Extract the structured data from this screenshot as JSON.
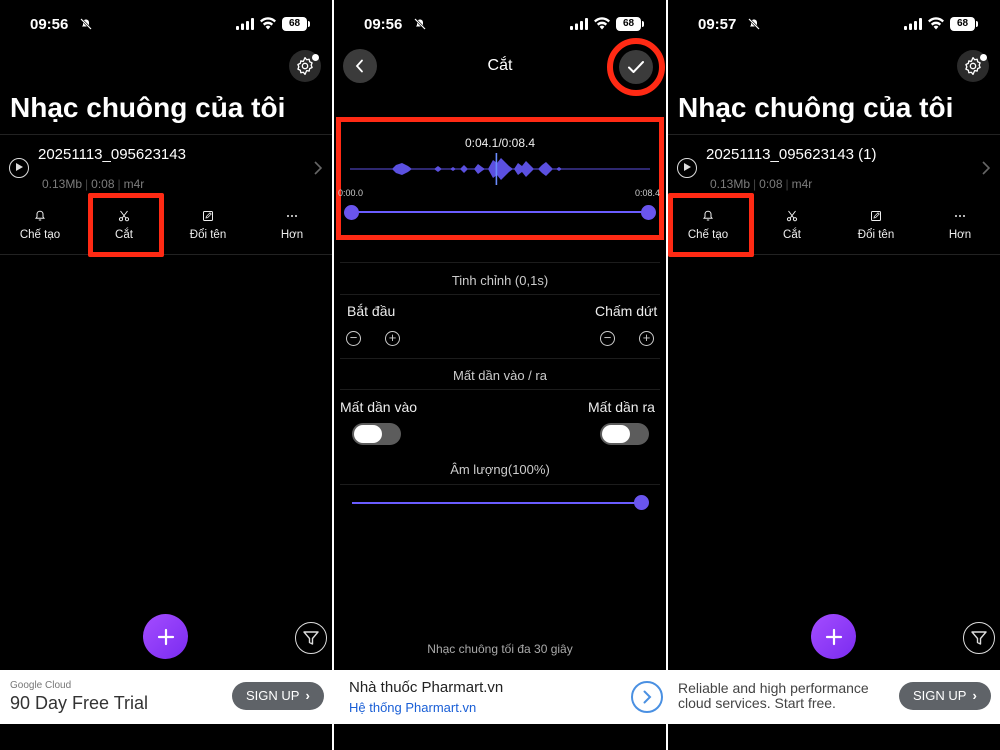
{
  "status_bars": [
    {
      "time": "09:56",
      "battery": "68"
    },
    {
      "time": "09:56",
      "battery": "68"
    },
    {
      "time": "09:57",
      "battery": "68"
    }
  ],
  "colors": {
    "highlight": "#ff2a14",
    "accent": "#6a5cff",
    "fab": "#8c3cf6",
    "background": "#000000"
  },
  "list_screen_1": {
    "title": "Nhạc chuông của tôi",
    "file_name": "20251113_095623143",
    "file_size": "0.13Mb",
    "duration": "0:08",
    "format": "m4r",
    "actions": [
      {
        "label": "Chế tạo",
        "icon": "bell-icon"
      },
      {
        "label": "Cắt",
        "icon": "scissors-icon"
      },
      {
        "label": "Đổi tên",
        "icon": "edit-icon"
      },
      {
        "label": "Hơn",
        "icon": "more-icon"
      }
    ],
    "highlighted_action": "Cắt"
  },
  "cut_screen": {
    "title": "Cắt",
    "current_time": "0:04.1",
    "total_time": "0:08.4",
    "range_start_label": "0:00.0",
    "range_end_label": "0:08.4",
    "fine_tune_label": "Tinh chỉnh (0,1s)",
    "start_label": "Bắt đầu",
    "end_label": "Chấm dứt",
    "fade_section_label": "Mất dần vào / ra",
    "fade_in_label": "Mất dần vào",
    "fade_out_label": "Mất dần ra",
    "fade_in_on": false,
    "fade_out_on": false,
    "volume_label": "Âm lượng(100%)",
    "volume_level": 1.0,
    "playhead_fraction": 0.488,
    "footer_note": "Nhạc chuông tối đa 30 giây"
  },
  "list_screen_2": {
    "title": "Nhạc chuông của tôi",
    "file_name": "20251113_095623143 (1)",
    "file_size": "0.13Mb",
    "duration": "0:08",
    "format": "m4r",
    "actions": [
      {
        "label": "Chế tạo",
        "icon": "bell-icon"
      },
      {
        "label": "Cắt",
        "icon": "scissors-icon"
      },
      {
        "label": "Đổi tên",
        "icon": "edit-icon"
      },
      {
        "label": "Hơn",
        "icon": "more-icon"
      }
    ],
    "highlighted_action": "Chế tạo"
  },
  "ads": {
    "google": {
      "small": "Google Cloud",
      "headline": "90 Day Free Trial",
      "cta": "SIGN UP"
    },
    "pharmart": {
      "title": "Nhà thuốc Pharmart.vn",
      "subtitle": "Hệ thống Pharmart.vn"
    },
    "reliable": {
      "line1": "Reliable and high performance",
      "line2": "cloud services. Start free.",
      "cta": "SIGN UP"
    }
  }
}
